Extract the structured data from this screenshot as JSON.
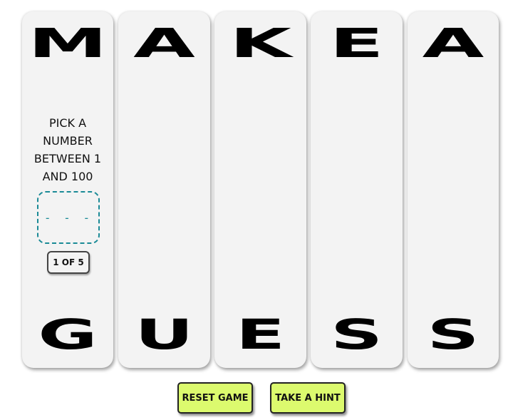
{
  "top_word": [
    "M",
    "A",
    "K",
    "E",
    "A"
  ],
  "bottom_word": [
    "G",
    "U",
    "E",
    "S",
    "S"
  ],
  "prompt": {
    "line1": "PICK A",
    "line2": "NUMBER",
    "line3": "BETWEEN 1",
    "line4": "AND 100"
  },
  "guess_input": {
    "placeholder": "- - -"
  },
  "attempt_counter": "1 OF 5",
  "buttons": {
    "reset_label": "RESET GAME",
    "hint_label": "TAKE A HINT"
  },
  "colors": {
    "card_bg": "#f3f3f3",
    "button_bg": "#dcfa6e",
    "input_border": "#1a8a96"
  }
}
